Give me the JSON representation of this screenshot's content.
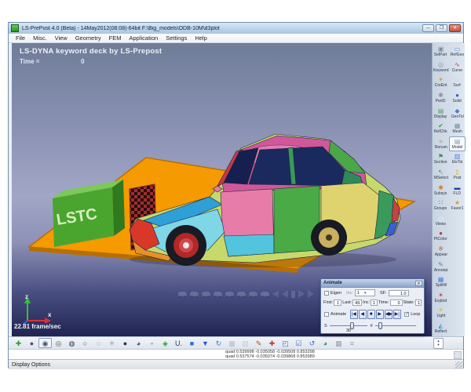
{
  "window": {
    "title": "LS-PrePost 4.0 (Beta) - 14May2012(08:08)-64bit F:\\Big_models\\ODB-10M\\d3plot",
    "minimize_glyph": "─",
    "maximize_glyph": "❐",
    "close_glyph": "✕"
  },
  "menu": {
    "items": [
      {
        "name": "menu-file",
        "label": "File"
      },
      {
        "name": "menu-misc",
        "label": "Misc."
      },
      {
        "name": "menu-view",
        "label": "View"
      },
      {
        "name": "menu-geometry",
        "label": "Geometry"
      },
      {
        "name": "menu-fem",
        "label": "FEM"
      },
      {
        "name": "menu-application",
        "label": "Application"
      },
      {
        "name": "menu-settings",
        "label": "Settings"
      },
      {
        "name": "menu-help",
        "label": "Help"
      }
    ]
  },
  "viewport": {
    "heading": "LS-DYNA keyword deck by LS-Prepost",
    "time_label": "Time =",
    "time_value": "0",
    "fps": "22.81 frame/sec",
    "lstc_logo_text": "LSTC",
    "axis_labels": {
      "z": "z",
      "x": "x"
    }
  },
  "sidebar": {
    "left_buttons": [
      {
        "name": "sidebar-selpart-button",
        "label": "SelPart",
        "glyph": "▣",
        "color": "#7d8ca2"
      },
      {
        "name": "sidebar-keyword-button",
        "label": "Keyword",
        "glyph": "◎",
        "color": "#8d95a5"
      },
      {
        "name": "sidebar-creent-button",
        "label": "CreEnt",
        "glyph": "✦",
        "color": "#d4a820"
      },
      {
        "name": "sidebar-partd-button",
        "label": "PartD",
        "glyph": "✱",
        "color": "#8a92a2"
      },
      {
        "name": "sidebar-display-button",
        "label": "Display",
        "glyph": "▤",
        "color": "#4ea05a"
      },
      {
        "name": "sidebar-refchk-button",
        "label": "RefChk",
        "glyph": "✔",
        "color": "#3f9f3f"
      },
      {
        "name": "sidebar-renum-button",
        "label": "Renum",
        "glyph": "≡",
        "color": "#b09a6a"
      },
      {
        "name": "sidebar-section-button",
        "label": "Section",
        "glyph": "⚑",
        "color": "#3f8f55"
      },
      {
        "name": "sidebar-mselect-button",
        "label": "MSelect",
        "glyph": "↖",
        "color": "#3f8f55"
      },
      {
        "name": "sidebar-subsys-button",
        "label": "Subsys",
        "glyph": "✺",
        "color": "#e07820"
      },
      {
        "name": "sidebar-groups-button",
        "label": "Groups",
        "glyph": "∷",
        "color": "#4565c5"
      },
      {
        "name": "sidebar-views-button",
        "label": "Views",
        "glyph": "▭",
        "color": "#f2f2f6"
      },
      {
        "name": "sidebar-ptcolor-button",
        "label": "PtColor",
        "glyph": "●",
        "color": "#cf3333"
      },
      {
        "name": "sidebar-appear-button",
        "label": "Appear",
        "glyph": "※",
        "color": "#a06838"
      },
      {
        "name": "sidebar-annotat-button",
        "label": "Annotat",
        "glyph": "✎",
        "color": "#6a7a9a"
      },
      {
        "name": "sidebar-splitw-button",
        "label": "SplitW",
        "glyph": "▦",
        "color": "#4a7fd4"
      },
      {
        "name": "sidebar-explod-button",
        "label": "Explod",
        "glyph": "✶",
        "color": "#d84028"
      },
      {
        "name": "sidebar-light-button",
        "label": "Light",
        "glyph": "☀",
        "color": "#e6bc1e"
      },
      {
        "name": "sidebar-reflect-button",
        "label": "Reflect",
        "glyph": "◭",
        "color": "#3aa0d0"
      }
    ],
    "right_buttons": [
      {
        "name": "sidebar-refgeo-button",
        "label": "RefGeo",
        "glyph": "▭",
        "color": "#4a7fd4"
      },
      {
        "name": "sidebar-curve-button",
        "label": "Curve",
        "glyph": "∿",
        "color": "#cf3333"
      },
      {
        "name": "sidebar-surf-button",
        "label": "Surf",
        "glyph": "▱",
        "color": "#c4c9d6"
      },
      {
        "name": "sidebar-solid-button",
        "label": "Solid",
        "glyph": "●",
        "color": "#2a5fd0"
      },
      {
        "name": "sidebar-geotol-button",
        "label": "GeoTol",
        "glyph": "◆",
        "color": "#4a7fd4"
      },
      {
        "name": "sidebar-mesh-button",
        "label": "Mesh",
        "glyph": "▦",
        "color": "#7d8ca2"
      },
      {
        "name": "sidebar-model-button",
        "label": "Model",
        "glyph": "▤",
        "color": "#8d99ad",
        "selected": true
      },
      {
        "name": "sidebar-eletol-button",
        "label": "EleTol",
        "glyph": "▥",
        "color": "#4a7fd4"
      },
      {
        "name": "sidebar-post-button",
        "label": "Post",
        "glyph": "▯",
        "color": "#d4a820"
      },
      {
        "name": "sidebar-fld-button",
        "label": "FLD",
        "glyph": "▬",
        "color": "#2040b0"
      },
      {
        "name": "sidebar-favor1-button",
        "label": "Favor1",
        "glyph": "★",
        "color": "#d8a020"
      }
    ]
  },
  "toolbar": {
    "icons": [
      {
        "name": "model-axes-icon",
        "glyph": "✚",
        "color": "#2f9e2f"
      },
      {
        "name": "smooth-shade-icon",
        "glyph": "●",
        "color": "#4a5260"
      },
      {
        "name": "shaded-edge-icon",
        "glyph": "◉",
        "color": "#4a5260",
        "selected": true
      },
      {
        "name": "wireframe-icon",
        "glyph": "◎",
        "color": "#4a5260"
      },
      {
        "name": "hidden-line-icon",
        "glyph": "◍",
        "color": "#2f3540"
      },
      {
        "name": "feature-edge-icon",
        "glyph": "○",
        "color": "#4a5260"
      },
      {
        "name": "mesh-lines-icon",
        "glyph": "◌",
        "color": "#4a5260"
      },
      {
        "name": "normals-icon",
        "glyph": "✳",
        "color": "#9aa0aa"
      },
      {
        "name": "shrink-element-icon",
        "glyph": "●",
        "color": "#2f3540"
      },
      {
        "name": "thick-shell-icon",
        "glyph": "◕",
        "color": "#4a5260"
      },
      {
        "name": "node-display-icon",
        "glyph": "◦",
        "color": "#2f3540"
      },
      {
        "name": "orientation-compass-icon",
        "glyph": "◈",
        "color": "#2f9e2f"
      },
      {
        "name": "units-icon",
        "glyph": "U.",
        "color": "#303a60"
      },
      {
        "name": "active-window-icon",
        "glyph": "■",
        "color": "#2a6fd4"
      },
      {
        "name": "part-filter-icon",
        "glyph": "▼",
        "color": "#2a4fd4"
      },
      {
        "name": "view-refresh-icon",
        "glyph": "↻",
        "color": "#3a7fd4"
      },
      {
        "name": "inactive-tool-icon",
        "glyph": "▩",
        "color": "#b8c0cc"
      },
      {
        "name": "inactive-tool-2-icon",
        "glyph": "▨",
        "color": "#c4ccd6"
      },
      {
        "name": "annotate-pencil-icon",
        "glyph": "✎",
        "color": "#b04a2a"
      },
      {
        "name": "add-view-icon",
        "glyph": "✚",
        "color": "#cc3030"
      },
      {
        "name": "zoom-select-icon",
        "glyph": "◰",
        "color": "#3a6fd4"
      },
      {
        "name": "check-edit-icon",
        "glyph": "☑",
        "color": "#3a6fd4"
      },
      {
        "name": "state-history-icon",
        "glyph": "↺",
        "color": "#3a6fd4"
      },
      {
        "name": "render-globe-icon",
        "glyph": "◕",
        "color": "#2f9e5f"
      },
      {
        "name": "screenshot-icon",
        "glyph": "▦",
        "color": "#9aa0aa"
      },
      {
        "name": "list-icon",
        "glyph": "≡",
        "color": "#9aa0aa"
      }
    ]
  },
  "animate_dialog": {
    "title": "Animate",
    "eigen_label": "Eigen",
    "inc_dropdown_label": "Inc:",
    "inc_dropdown_value": "1",
    "sf_label": "SF:",
    "sf_value": "1.0",
    "first_label": "First:",
    "first_value": "1",
    "last_label": "Last:",
    "last_value": "49",
    "inc_label": "Inc:",
    "inc_value": "1",
    "time_label": "Time:",
    "time_value": "0",
    "state_label": "State:",
    "state_value": "1",
    "animate_label": "Animate",
    "loop_label": "Loop",
    "speed_label": "S",
    "frame_label": "#",
    "speed_value": "30",
    "buttons": [
      {
        "name": "first-frame-button",
        "glyph": "|◀"
      },
      {
        "name": "prev-frame-button",
        "glyph": "◀"
      },
      {
        "name": "stop-button",
        "glyph": "■"
      },
      {
        "name": "play-button",
        "glyph": "▶"
      },
      {
        "name": "bounce-button",
        "glyph": "◀▶"
      },
      {
        "name": "last-frame-button",
        "glyph": "▶|"
      }
    ]
  },
  "command_area": {
    "lines": [
      {
        "text": "quad 0.539998 -0.035058 -0.039508 0.853298"
      },
      {
        "text": "quad 0.537574 -0.035074 -0.039868 0.853989"
      }
    ]
  },
  "status_bar": {
    "text": "Display Options"
  }
}
